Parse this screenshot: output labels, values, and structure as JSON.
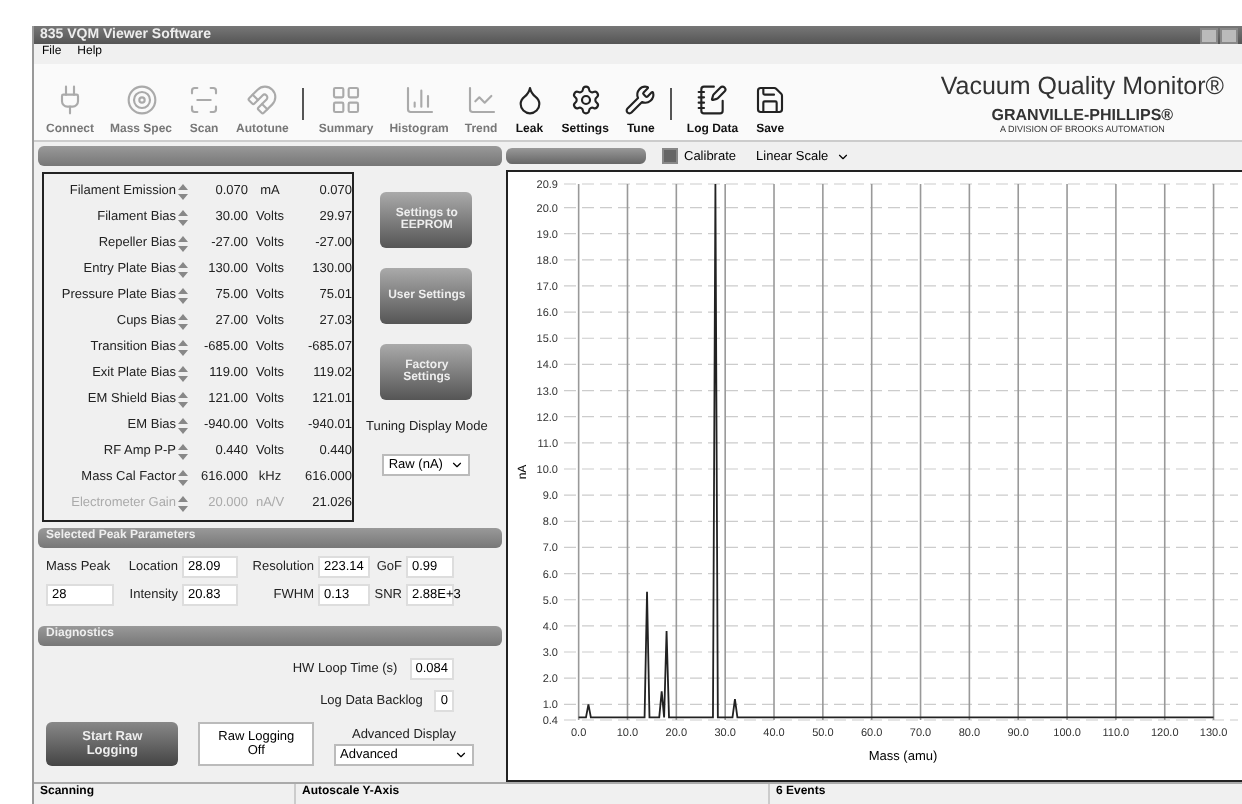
{
  "window": {
    "title": "835 VQM Viewer Software"
  },
  "menu": [
    "File",
    "Help"
  ],
  "toolbar": [
    {
      "kind": "button",
      "label": "Connect",
      "disabled": true
    },
    {
      "kind": "button",
      "label": "Mass Spec",
      "disabled": true
    },
    {
      "kind": "button",
      "label": "Scan",
      "disabled": true
    },
    {
      "kind": "button",
      "label": "Autotune",
      "disabled": true
    },
    {
      "kind": "separator"
    },
    {
      "kind": "button",
      "label": "Summary",
      "disabled": true
    },
    {
      "kind": "button",
      "label": "Histogram",
      "disabled": true
    },
    {
      "kind": "button",
      "label": "Trend",
      "disabled": true
    },
    {
      "kind": "button",
      "label": "Leak",
      "disabled": false
    },
    {
      "kind": "button",
      "label": "Settings",
      "disabled": false
    },
    {
      "kind": "button",
      "label": "Tune",
      "disabled": false
    },
    {
      "kind": "separator"
    },
    {
      "kind": "button",
      "label": "Log Data",
      "disabled": false
    },
    {
      "kind": "button",
      "label": "Save",
      "disabled": false
    }
  ],
  "logo": {
    "title": "Vacuum Quality Monitor®",
    "brand": "GRANVILLE-PHILLIPS®",
    "tagline": "A DIVISION OF BROOKS AUTOMATION"
  },
  "parameters": {
    "rows": [
      {
        "name": "Filament Emission",
        "setpoint": "0.070",
        "unit": "mA",
        "reading": "0.070",
        "disabled": false
      },
      {
        "name": "Filament Bias",
        "setpoint": "30.00",
        "unit": "Volts",
        "reading": "29.97",
        "disabled": false
      },
      {
        "name": "Repeller Bias",
        "setpoint": "-27.00",
        "unit": "Volts",
        "reading": "-27.00",
        "disabled": false
      },
      {
        "name": "Entry Plate Bias",
        "setpoint": "130.00",
        "unit": "Volts",
        "reading": "130.00",
        "disabled": false
      },
      {
        "name": "Pressure Plate Bias",
        "setpoint": "75.00",
        "unit": "Volts",
        "reading": "75.01",
        "disabled": false
      },
      {
        "name": "Cups Bias",
        "setpoint": "27.00",
        "unit": "Volts",
        "reading": "27.03",
        "disabled": false
      },
      {
        "name": "Transition Bias",
        "setpoint": "-685.00",
        "unit": "Volts",
        "reading": "-685.07",
        "disabled": false
      },
      {
        "name": "Exit Plate Bias",
        "setpoint": "119.00",
        "unit": "Volts",
        "reading": "119.02",
        "disabled": false
      },
      {
        "name": "EM Shield Bias",
        "setpoint": "121.00",
        "unit": "Volts",
        "reading": "121.01",
        "disabled": false
      },
      {
        "name": "EM Bias",
        "setpoint": "-940.00",
        "unit": "Volts",
        "reading": "-940.01",
        "disabled": false
      },
      {
        "name": "RF Amp P-P",
        "setpoint": "0.440",
        "unit": "Volts",
        "reading": "0.440",
        "disabled": false
      },
      {
        "name": "Mass Cal Factor",
        "setpoint": "616.000",
        "unit": "kHz",
        "reading": "616.000",
        "disabled": false
      },
      {
        "name": "Electrometer Gain",
        "setpoint": "20.000",
        "unit": "nA/V",
        "reading": "21.026",
        "disabled": true
      }
    ],
    "buttons": [
      "Settings to EEPROM",
      "User Settings",
      "Factory Settings"
    ],
    "display_mode": {
      "label": "Tuning Display Mode",
      "value": "Raw (nA)"
    }
  },
  "peak": {
    "title": "Selected Peak Parameters",
    "mass_label": "Mass Peak",
    "mass": "28",
    "fields": [
      {
        "label": "Location",
        "value": "28.09"
      },
      {
        "label": "Resolution",
        "value": "223.14"
      },
      {
        "label": "GoF",
        "value": "0.99"
      },
      {
        "label": "Intensity",
        "value": "20.83"
      },
      {
        "label": "FWHM",
        "value": "0.13"
      },
      {
        "label": "SNR",
        "value": "2.88E+3"
      }
    ]
  },
  "diagnostics": {
    "title": "Diagnostics",
    "loop_label": "HW Loop Time (s)",
    "loop": "0.084",
    "backlog_label": "Log Data Backlog",
    "backlog": "0",
    "advanced_label": "Advanced Display",
    "advanced": "Advanced",
    "start_button": "Start Raw Logging",
    "logging_state": "Raw Logging Off"
  },
  "spectrum": {
    "calibrate": {
      "label": "Calibrate",
      "checked": true
    },
    "scale": "Linear Scale",
    "chart_data": {
      "type": "line",
      "xlabel": "Mass (amu)",
      "ylabel": "nA",
      "xlim": [
        -3,
        135
      ],
      "ylim": [
        0.4,
        20.9
      ],
      "grid": true,
      "xticks": [
        {
          "value": 0,
          "label": "0.0"
        },
        {
          "value": 10,
          "label": "10.0"
        },
        {
          "value": 20,
          "label": "20.0"
        },
        {
          "value": 30,
          "label": "30.0"
        },
        {
          "value": 40,
          "label": "40.0"
        },
        {
          "value": 50,
          "label": "50.0"
        },
        {
          "value": 60,
          "label": "60.0"
        },
        {
          "value": 70,
          "label": "70.0"
        },
        {
          "value": 80,
          "label": "80.0"
        },
        {
          "value": 90,
          "label": "90.0"
        },
        {
          "value": 100,
          "label": "100.0"
        },
        {
          "value": 110,
          "label": "110.0"
        },
        {
          "value": 120,
          "label": "120.0"
        },
        {
          "value": 130,
          "label": "130.0"
        }
      ],
      "yticks": [
        {
          "value": 0.4,
          "label": "0.4"
        },
        {
          "value": 1,
          "label": "1.0"
        },
        {
          "value": 2,
          "label": "2.0"
        },
        {
          "value": 3,
          "label": "3.0"
        },
        {
          "value": 4,
          "label": "4.0"
        },
        {
          "value": 5,
          "label": "5.0"
        },
        {
          "value": 6,
          "label": "6.0"
        },
        {
          "value": 7,
          "label": "7.0"
        },
        {
          "value": 8,
          "label": "8.0"
        },
        {
          "value": 9,
          "label": "9.0"
        },
        {
          "value": 10,
          "label": "10.0"
        },
        {
          "value": 11,
          "label": "11.0"
        },
        {
          "value": 12,
          "label": "12.0"
        },
        {
          "value": 13,
          "label": "13.0"
        },
        {
          "value": 14,
          "label": "14.0"
        },
        {
          "value": 15,
          "label": "15.0"
        },
        {
          "value": 16,
          "label": "16.0"
        },
        {
          "value": 17,
          "label": "17.0"
        },
        {
          "value": 18,
          "label": "18.0"
        },
        {
          "value": 19,
          "label": "19.0"
        },
        {
          "value": 20,
          "label": "20.0"
        },
        {
          "value": 20.9,
          "label": "20.9"
        }
      ],
      "x": [
        0,
        1.5,
        2,
        2.5,
        13.5,
        14,
        14.5,
        16.5,
        17,
        17.5,
        18,
        18.5,
        27.5,
        28,
        28.5,
        31.5,
        32,
        32.5,
        130
      ],
      "series": [
        {
          "color": "#222222",
          "values": [
            0.5,
            0.5,
            1.0,
            0.5,
            0.5,
            5.3,
            0.5,
            0.5,
            1.5,
            0.5,
            3.8,
            0.5,
            0.5,
            20.9,
            0.5,
            0.5,
            1.2,
            0.5,
            0.5
          ]
        }
      ]
    }
  },
  "status_bar": [
    "Scanning",
    "Autoscale Y-Axis",
    "6 Events"
  ]
}
